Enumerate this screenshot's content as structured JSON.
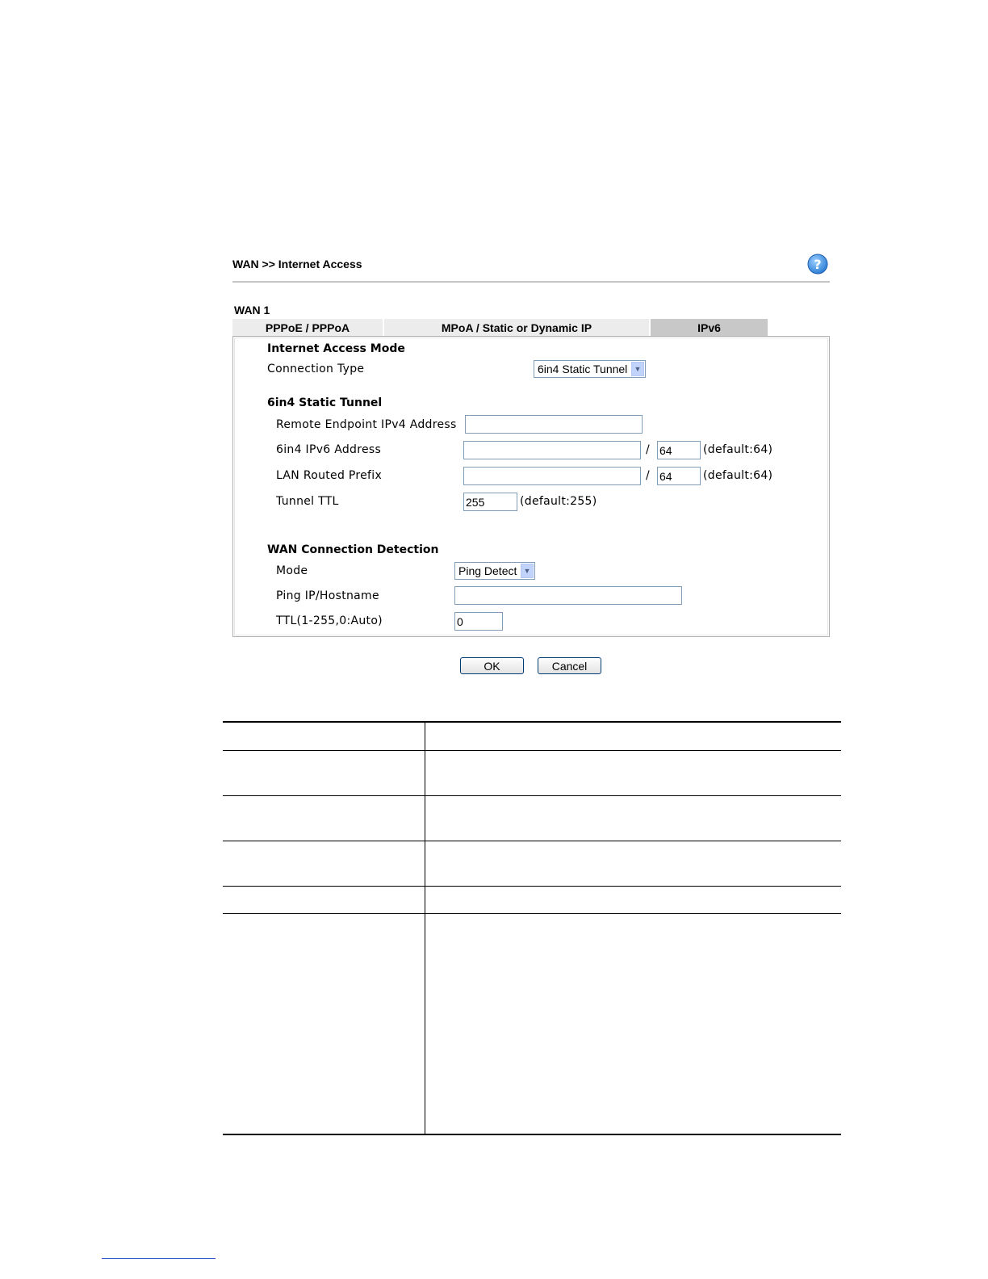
{
  "header": {
    "breadcrumb": "WAN >> Internet Access"
  },
  "wan_label": "WAN 1",
  "tabs": [
    {
      "label": "PPPoE / PPPoA",
      "active": false
    },
    {
      "label": "MPoA / Static or Dynamic IP",
      "active": false
    },
    {
      "label": "IPv6",
      "active": true
    }
  ],
  "access_mode": {
    "heading": "Internet Access Mode",
    "connection_type_label": "Connection Type",
    "connection_type_value": "6in4 Static Tunnel"
  },
  "tunnel": {
    "heading": "6in4 Static Tunnel",
    "remote_endpoint_label": "Remote Endpoint IPv4 Address",
    "remote_endpoint_value": "",
    "ipv6_address_label": "6in4 IPv6 Address",
    "ipv6_address_value": "",
    "ipv6_prefix_len": "64",
    "lan_prefix_label": "LAN Routed Prefix",
    "lan_prefix_value": "",
    "lan_prefix_len": "64",
    "slash": "/",
    "default_64": "(default:64)",
    "ttl_label": "Tunnel TTL",
    "ttl_value": "255",
    "ttl_default": "(default:255)"
  },
  "detection": {
    "heading": "WAN Connection Detection",
    "mode_label": "Mode",
    "mode_value": "Ping Detect",
    "ping_label": "Ping IP/Hostname",
    "ping_value": "",
    "ttl_label": "TTL(1-255,0:Auto)",
    "ttl_value": "0"
  },
  "buttons": {
    "ok": "OK",
    "cancel": "Cancel"
  },
  "colors": {
    "help_icon": "#3b8ee0",
    "tab_bg": "#ececec",
    "tab_active_bg": "#c8c8c8",
    "panel_border": "#b0b0b0"
  },
  "icons": {
    "help": "question-mark-circle",
    "dropdown": "chevron-down"
  }
}
